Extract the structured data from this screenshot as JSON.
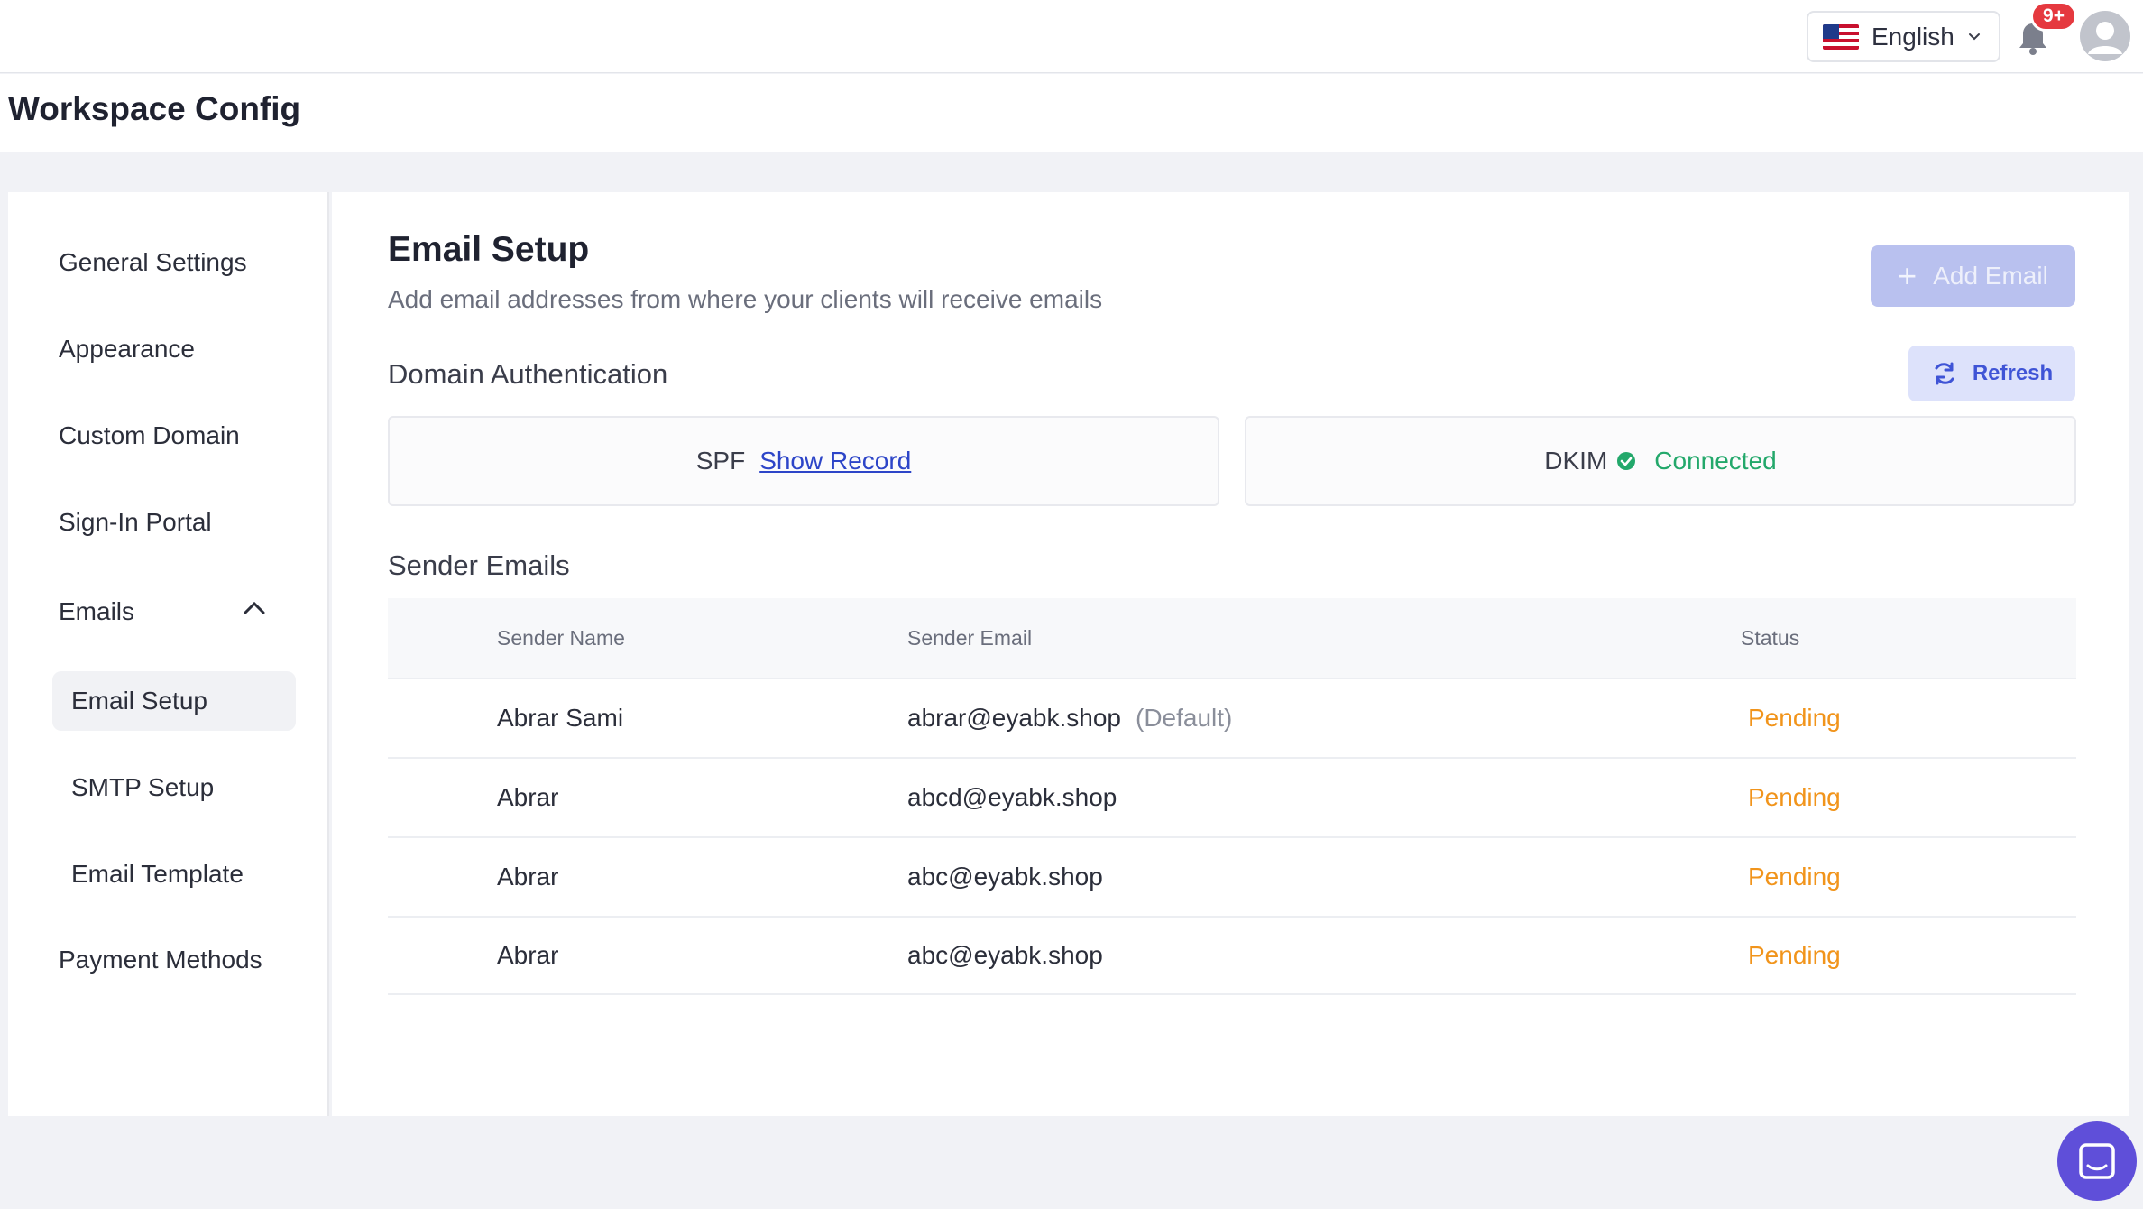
{
  "header": {
    "language": "English",
    "notification_badge": "9+"
  },
  "page": {
    "title": "Workspace Config"
  },
  "sidebar": {
    "items": [
      {
        "label": "General Settings"
      },
      {
        "label": "Appearance"
      },
      {
        "label": "Custom Domain"
      },
      {
        "label": "Sign-In Portal"
      },
      {
        "label": "Emails"
      },
      {
        "label": "Email Setup"
      },
      {
        "label": "SMTP Setup"
      },
      {
        "label": "Email Template"
      },
      {
        "label": "Payment Methods"
      }
    ],
    "active": "Email Setup"
  },
  "main": {
    "title": "Email Setup",
    "subtitle": "Add email addresses from where your clients will receive emails",
    "add_email_label": "Add Email",
    "domain_auth_title": "Domain Authentication",
    "refresh_label": "Refresh",
    "spf": {
      "label": "SPF",
      "link": "Show Record"
    },
    "dkim": {
      "label": "DKIM",
      "status": "Connected"
    },
    "sender_title": "Sender Emails",
    "table": {
      "headers": [
        "Sender Name",
        "Sender Email",
        "Status"
      ],
      "rows": [
        {
          "name": "Abrar Sami",
          "email": "abrar@eyabk.shop",
          "tag": "(Default)",
          "status": "Pending"
        },
        {
          "name": "Abrar",
          "email": "abcd@eyabk.shop",
          "tag": "",
          "status": "Pending"
        },
        {
          "name": "Abrar",
          "email": "abc@eyabk.shop",
          "tag": "",
          "status": "Pending"
        },
        {
          "name": "Abrar",
          "email": "abc@eyabk.shop",
          "tag": "",
          "status": "Pending"
        }
      ]
    }
  },
  "colors": {
    "accent": "#3f54d6",
    "pending": "#f1941b",
    "connected": "#23a86b",
    "badge": "#e5393f",
    "chat": "#5f4fd9"
  }
}
